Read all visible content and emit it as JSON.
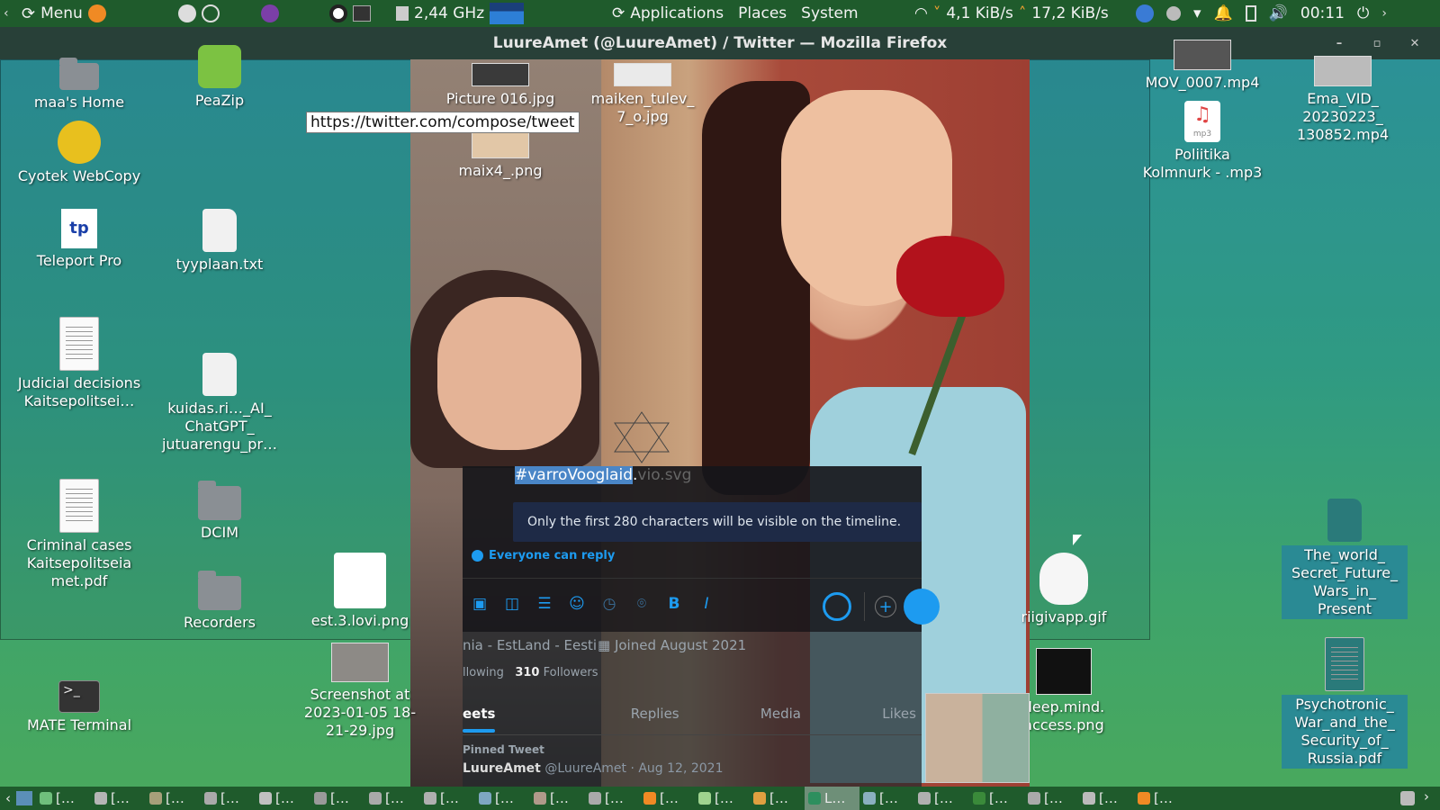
{
  "top_panel": {
    "menu_label": "Menu",
    "cpu_freq": "2,44 GHz",
    "applications": "Applications",
    "places": "Places",
    "system": "System",
    "net_down": "4,1 KiB/s",
    "net_up": "17,2 KiB/s",
    "clock": "00:11"
  },
  "window": {
    "title": "LuureAmet (@LuureAmet) / Twitter — Mozilla Firefox"
  },
  "url_tooltip": "https://twitter.com/compose/tweet",
  "desktop_icons": {
    "home": "maa's Home",
    "peazip": "PeaZip",
    "cyotek": "Cyotek WebCopy",
    "teleport": "Teleport Pro",
    "tyyplaan": "tyyplaan.txt",
    "judicial": "Judicial decisions Kaitsepolitsei…",
    "kuidas": "kuidas.ri…_AI_ ChatGPT_ jutuarengu_pr…",
    "criminal": "Criminal cases Kaitsepolitseia met.pdf",
    "dcim": "DCIM",
    "recorders": "Recorders",
    "est_lovi": "est.3.lovi.png",
    "screenshot": "Screenshot at 2023-01-05 18-21-29.jpg",
    "terminal": "MATE Terminal",
    "picture016": "Picture 016.jpg",
    "maiken": "maiken_tulev_ 7_o.jpg",
    "maix4": "maix4_.png",
    "mov": "MOV_0007.mp4",
    "ema_vid": "Ema_VID_ 20230223_ 130852.mp4",
    "politiika": "Poliitika Kolmnurk - .mp3",
    "riigivapp": "riigivapp.gif",
    "deepmind": "deep.mind. access.png",
    "world": "The_world_ Secret_Future_ Wars_in_ Present",
    "psychotronic": "Psychotronic_ War_and_the_ Security_of_ Russia.pdf",
    "mp3_badge": "mp3"
  },
  "compose": {
    "hashtag": "#varroVooglaid",
    "trailing": ".",
    "ghost_text": "vio.svg",
    "notice": "Only the first 280 characters will be visible on the timeline.",
    "reply_setting": "Everyone can reply"
  },
  "profile": {
    "location": "nia - EstLand - Eesti",
    "joined": "Joined August 2021",
    "following_label": "llowing",
    "followers_count": "310",
    "followers_label": "Followers",
    "tabs": [
      "eets",
      "Replies",
      "Media",
      "Likes"
    ],
    "pinned": "Pinned Tweet",
    "author_name": "LuureAmet",
    "author_handle": "@LuureAmet · Aug 12, 2021"
  },
  "taskbar": {
    "items": [
      "[…",
      "[…",
      "[…",
      "[…",
      "[…",
      "[…",
      "[…",
      "[…",
      "[…",
      "[…",
      "[…",
      "[…",
      "[…",
      "[…",
      "L…",
      "[…",
      "[…",
      "[…",
      "[…",
      "[…",
      "[…"
    ]
  },
  "colors": {
    "panel": "#1f5b2c",
    "twitter_blue": "#1d9bf0"
  }
}
